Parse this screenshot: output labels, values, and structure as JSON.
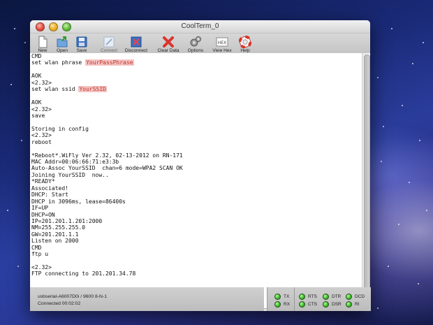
{
  "window": {
    "title": "CoolTerm_0"
  },
  "toolbar": {
    "items": [
      {
        "label": "New",
        "icon": "new-document-icon",
        "enabled": true
      },
      {
        "label": "Open",
        "icon": "open-folder-icon",
        "enabled": true
      },
      {
        "label": "Save",
        "icon": "save-disk-icon",
        "enabled": true
      },
      {
        "label": "Connect",
        "icon": "connect-icon",
        "enabled": false
      },
      {
        "label": "Disconnect",
        "icon": "disconnect-icon",
        "enabled": true
      },
      {
        "label": "Clear Data",
        "icon": "clear-x-icon",
        "enabled": true
      },
      {
        "label": "Options",
        "icon": "gears-icon",
        "enabled": true
      },
      {
        "label": "View Hex",
        "icon": "hex-icon",
        "enabled": true
      },
      {
        "label": "Help",
        "icon": "lifebuoy-icon",
        "enabled": true
      }
    ]
  },
  "terminal": {
    "lines": [
      {
        "text": "CMD"
      },
      {
        "text": "set wlan phrase ",
        "hl": "YourPassPhrase"
      },
      {
        "text": ""
      },
      {
        "text": "AOK"
      },
      {
        "text": "<2.32>"
      },
      {
        "text": "set wlan ssid ",
        "hl": "YourSSID"
      },
      {
        "text": ""
      },
      {
        "text": "AOK"
      },
      {
        "text": "<2.32>"
      },
      {
        "text": "save"
      },
      {
        "text": ""
      },
      {
        "text": "Storing in config"
      },
      {
        "text": "<2.32>"
      },
      {
        "text": "reboot"
      },
      {
        "text": ""
      },
      {
        "text": "*Reboot*.WiFly Ver 2.32, 02-13-2012 on RN-171"
      },
      {
        "text": "MAC Addr=00:06:66:71:e3:3b"
      },
      {
        "text": "Auto-Assoc YourSSID  chan=6 mode=WPA2 SCAN OK"
      },
      {
        "text": "Joining YourSSID  now.."
      },
      {
        "text": "*READY*"
      },
      {
        "text": "Associated!"
      },
      {
        "text": "DHCP: Start"
      },
      {
        "text": "DHCP in 3096ms, lease=86400s"
      },
      {
        "text": "IF=UP"
      },
      {
        "text": "DHCP=ON"
      },
      {
        "text": "IP=201.201.1.201:2000"
      },
      {
        "text": "NM=255.255.255.0"
      },
      {
        "text": "GW=201.201.1.1"
      },
      {
        "text": "Listen on 2000"
      },
      {
        "text": "CMD"
      },
      {
        "text": "ftp u"
      },
      {
        "text": ""
      },
      {
        "text": "<2.32>"
      },
      {
        "text": "FTP connecting to 201.201.34.78"
      }
    ]
  },
  "status": {
    "port": "usbserial-A6007D0i / 9600 8-N-1",
    "connection": "Connected 00:02:02"
  },
  "indicators": [
    {
      "label": "TX",
      "state": "on"
    },
    {
      "label": "RX",
      "state": "on"
    },
    {
      "label": "RTS",
      "state": "on"
    },
    {
      "label": "CTS",
      "state": "on"
    },
    {
      "label": "DTR",
      "state": "on"
    },
    {
      "label": "DSR",
      "state": "on"
    },
    {
      "label": "DCD",
      "state": "on"
    },
    {
      "label": "RI",
      "state": "on"
    }
  ],
  "colors": {
    "highlight_bg": "#f4c4c4",
    "highlight_text": "#c0392b",
    "led_on": "#2fb61a"
  }
}
